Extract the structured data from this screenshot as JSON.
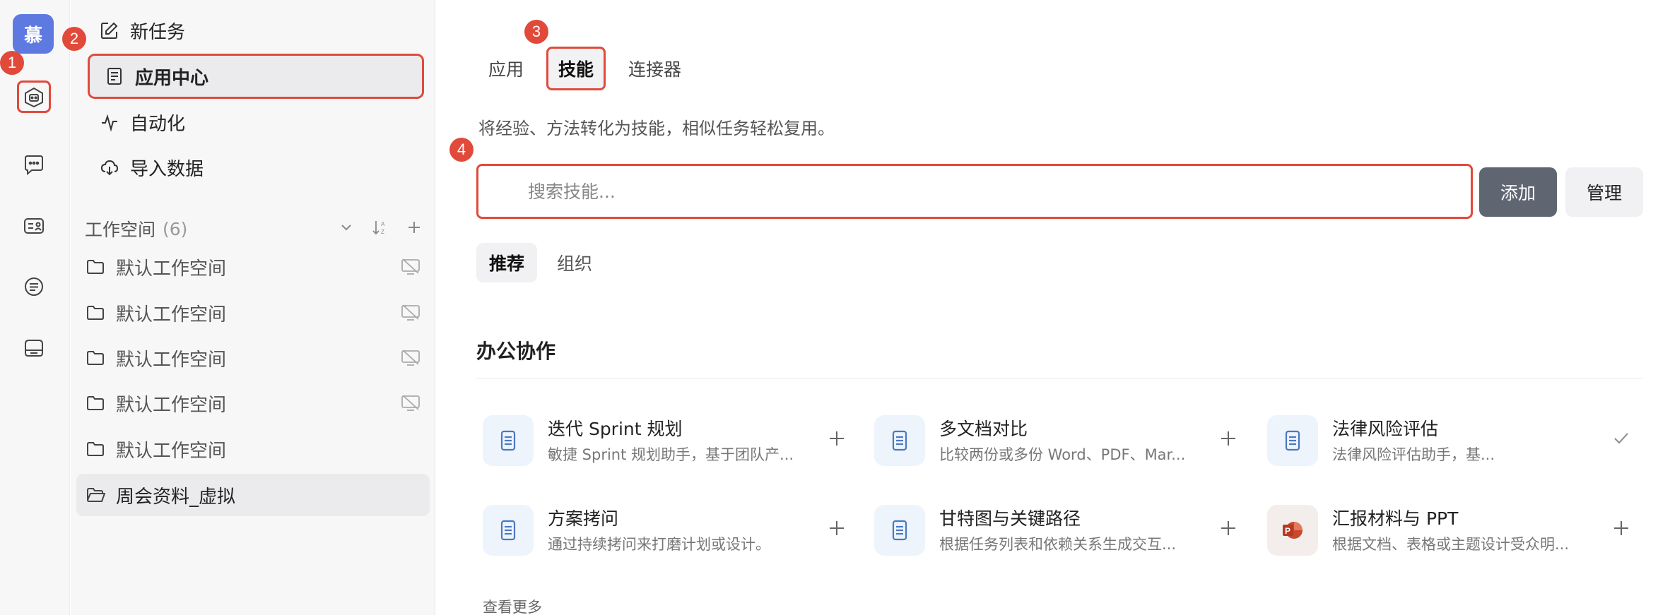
{
  "rail": {
    "avatar_text": "慕",
    "items": [
      "app-center",
      "chat",
      "id-card",
      "notes",
      "storage"
    ]
  },
  "sidebar": {
    "nav": [
      {
        "label": "新任务",
        "icon": "edit-icon"
      },
      {
        "label": "应用中心",
        "icon": "document-icon"
      },
      {
        "label": "自动化",
        "icon": "pulse-icon"
      },
      {
        "label": "导入数据",
        "icon": "cloud-download-icon"
      }
    ],
    "workspace": {
      "title": "工作空间",
      "count": "(6)",
      "items": [
        {
          "label": "默认工作空间"
        },
        {
          "label": "默认工作空间"
        },
        {
          "label": "默认工作空间"
        },
        {
          "label": "默认工作空间"
        },
        {
          "label": "默认工作空间"
        },
        {
          "label": "周会资料_虚拟"
        }
      ]
    }
  },
  "badges": [
    "1",
    "2",
    "3",
    "4"
  ],
  "main": {
    "tabs": [
      {
        "label": "应用"
      },
      {
        "label": "技能"
      },
      {
        "label": "连接器"
      }
    ],
    "description": "将经验、方法转化为技能，相似任务轻松复用。",
    "search": {
      "placeholder": "搜索技能..."
    },
    "add_label": "添加",
    "manage_label": "管理",
    "subtabs": [
      {
        "label": "推荐"
      },
      {
        "label": "组织"
      }
    ],
    "section_title": "办公协作",
    "cards": [
      {
        "title": "迭代 Sprint 规划",
        "desc": "敏捷 Sprint 规划助手，基于团队产...",
        "action": "plus"
      },
      {
        "title": "多文档对比",
        "desc": "比较两份或多份 Word、PDF、Mar...",
        "action": "plus"
      },
      {
        "title": "法律风险评估",
        "desc": "法律风险评估助手，基...",
        "action": "check"
      },
      {
        "title": "方案拷问",
        "desc": "通过持续拷问来打磨计划或设计。",
        "action": "plus"
      },
      {
        "title": "甘特图与关键路径",
        "desc": "根据任务列表和依赖关系生成交互...",
        "action": "plus"
      },
      {
        "title": "汇报材料与 PPT",
        "desc": "根据文档、表格或主题设计受众明...",
        "action": "plus"
      }
    ],
    "see_more": "查看更多"
  },
  "colors": {
    "highlight": "#e14a3b",
    "avatar_bg": "#5e7ae0",
    "add_button": "#5f6672",
    "card_icon": "#4a78c2",
    "ppt_icon": "#c8472d"
  }
}
